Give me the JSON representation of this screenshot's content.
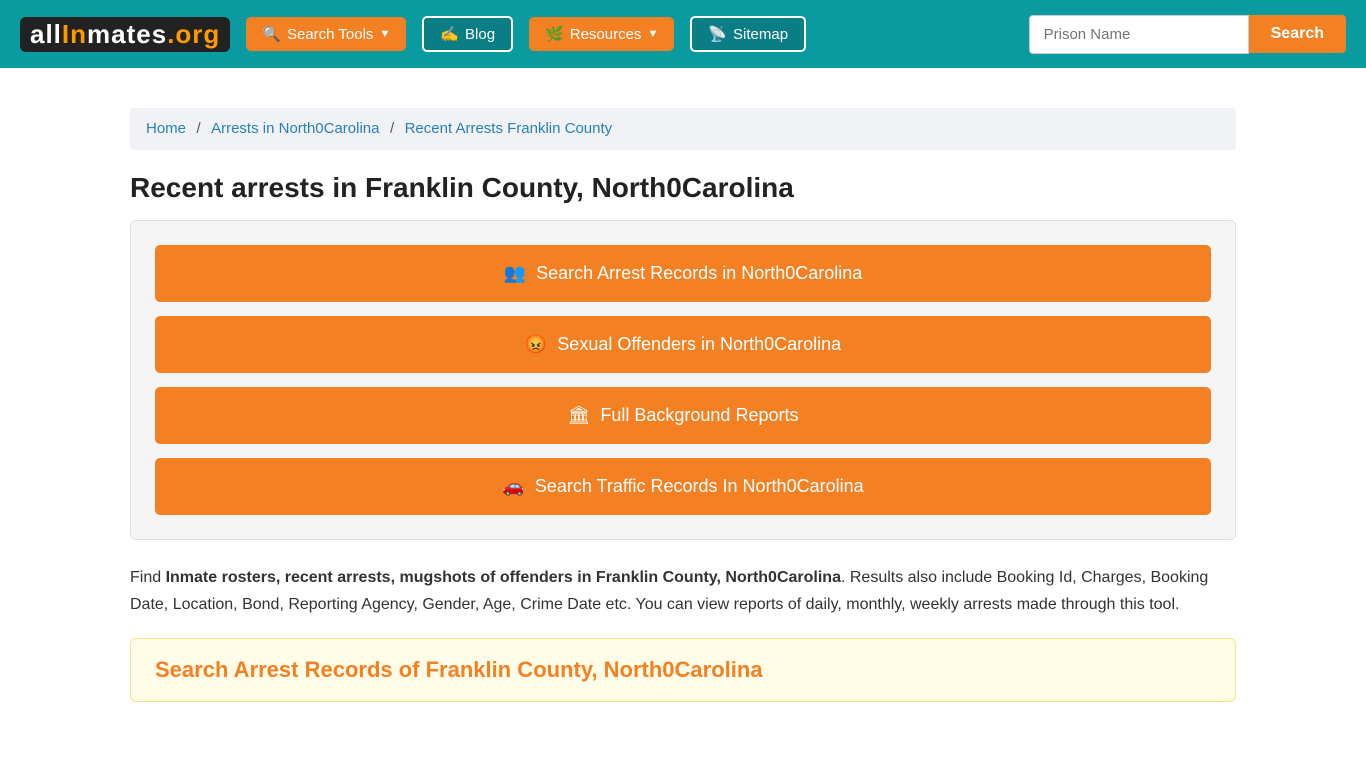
{
  "header": {
    "logo": {
      "all": "all",
      "in": "In",
      "mates": "mates",
      "org": ".org"
    },
    "nav": [
      {
        "id": "search-tools",
        "label": "Search Tools",
        "hasArrow": true,
        "style": "orange"
      },
      {
        "id": "blog",
        "label": "Blog",
        "hasArrow": false,
        "style": "outline"
      },
      {
        "id": "resources",
        "label": "Resources",
        "hasArrow": true,
        "style": "orange"
      },
      {
        "id": "sitemap",
        "label": "Sitemap",
        "hasArrow": false,
        "style": "outline"
      }
    ],
    "search": {
      "placeholder": "Prison Name",
      "button_label": "Search"
    }
  },
  "breadcrumb": {
    "items": [
      {
        "label": "Home",
        "href": "#"
      },
      {
        "label": "Arrests in North0Carolina",
        "href": "#"
      },
      {
        "label": "Recent Arrests Franklin County",
        "href": "#"
      }
    ]
  },
  "page": {
    "title": "Recent arrests in Franklin County, North0Carolina",
    "action_buttons": [
      {
        "id": "arrest-records",
        "icon": "people",
        "label": "Search Arrest Records in North0Carolina"
      },
      {
        "id": "sexual-offenders",
        "icon": "offender",
        "label": "Sexual Offenders in North0Carolina"
      },
      {
        "id": "background-reports",
        "icon": "bg",
        "label": "Full Background Reports"
      },
      {
        "id": "traffic-records",
        "icon": "car",
        "label": "Search Traffic Records In North0Carolina"
      }
    ],
    "description_prefix": "Find ",
    "description_bold": "Inmate rosters, recent arrests, mugshots of offenders in Franklin County, North0Carolina",
    "description_suffix": ". Results also include Booking Id, Charges, Booking Date, Location, Bond, Reporting Agency, Gender, Age, Crime Date etc. You can view reports of daily, monthly, weekly arrests made through this tool.",
    "search_records_heading": "Search Arrest Records of Franklin County, North0Carolina"
  }
}
